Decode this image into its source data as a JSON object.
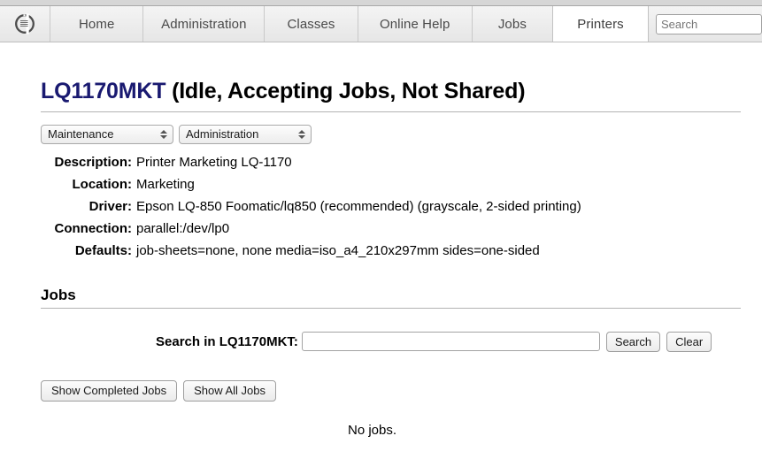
{
  "header": {
    "logo_icon": "cups-logo-icon",
    "tabs": [
      {
        "label": "Home",
        "active": false
      },
      {
        "label": "Administration",
        "active": false
      },
      {
        "label": "Classes",
        "active": false
      },
      {
        "label": "Online Help",
        "active": false
      },
      {
        "label": "Jobs",
        "active": false
      },
      {
        "label": "Printers",
        "active": true
      }
    ],
    "search": {
      "placeholder": "Search",
      "value": ""
    }
  },
  "page": {
    "printer_name": "LQ1170MKT",
    "printer_state": "(Idle, Accepting Jobs, Not Shared)"
  },
  "controls": {
    "maintenance_select": {
      "selected": "Maintenance"
    },
    "administration_select": {
      "selected": "Administration"
    }
  },
  "details": [
    {
      "label": "Description:",
      "value": "Printer Marketing LQ-1170"
    },
    {
      "label": "Location:",
      "value": "Marketing"
    },
    {
      "label": "Driver:",
      "value": "Epson LQ-850 Foomatic/lq850 (recommended) (grayscale, 2-sided printing)"
    },
    {
      "label": "Connection:",
      "value": "parallel:/dev/lp0"
    },
    {
      "label": "Defaults:",
      "value": "job-sheets=none, none media=iso_a4_210x297mm sides=one-sided"
    }
  ],
  "jobs": {
    "heading": "Jobs",
    "search_label": "Search in LQ1170MKT:",
    "search_value": "",
    "search_placeholder": "",
    "search_button": "Search",
    "clear_button": "Clear",
    "show_completed_button": "Show Completed Jobs",
    "show_all_button": "Show All Jobs",
    "empty_message": "No jobs."
  },
  "colors": {
    "printer_name": "#191970",
    "tab_text": "#4a4a4a",
    "rule": "#b3b3b3"
  }
}
